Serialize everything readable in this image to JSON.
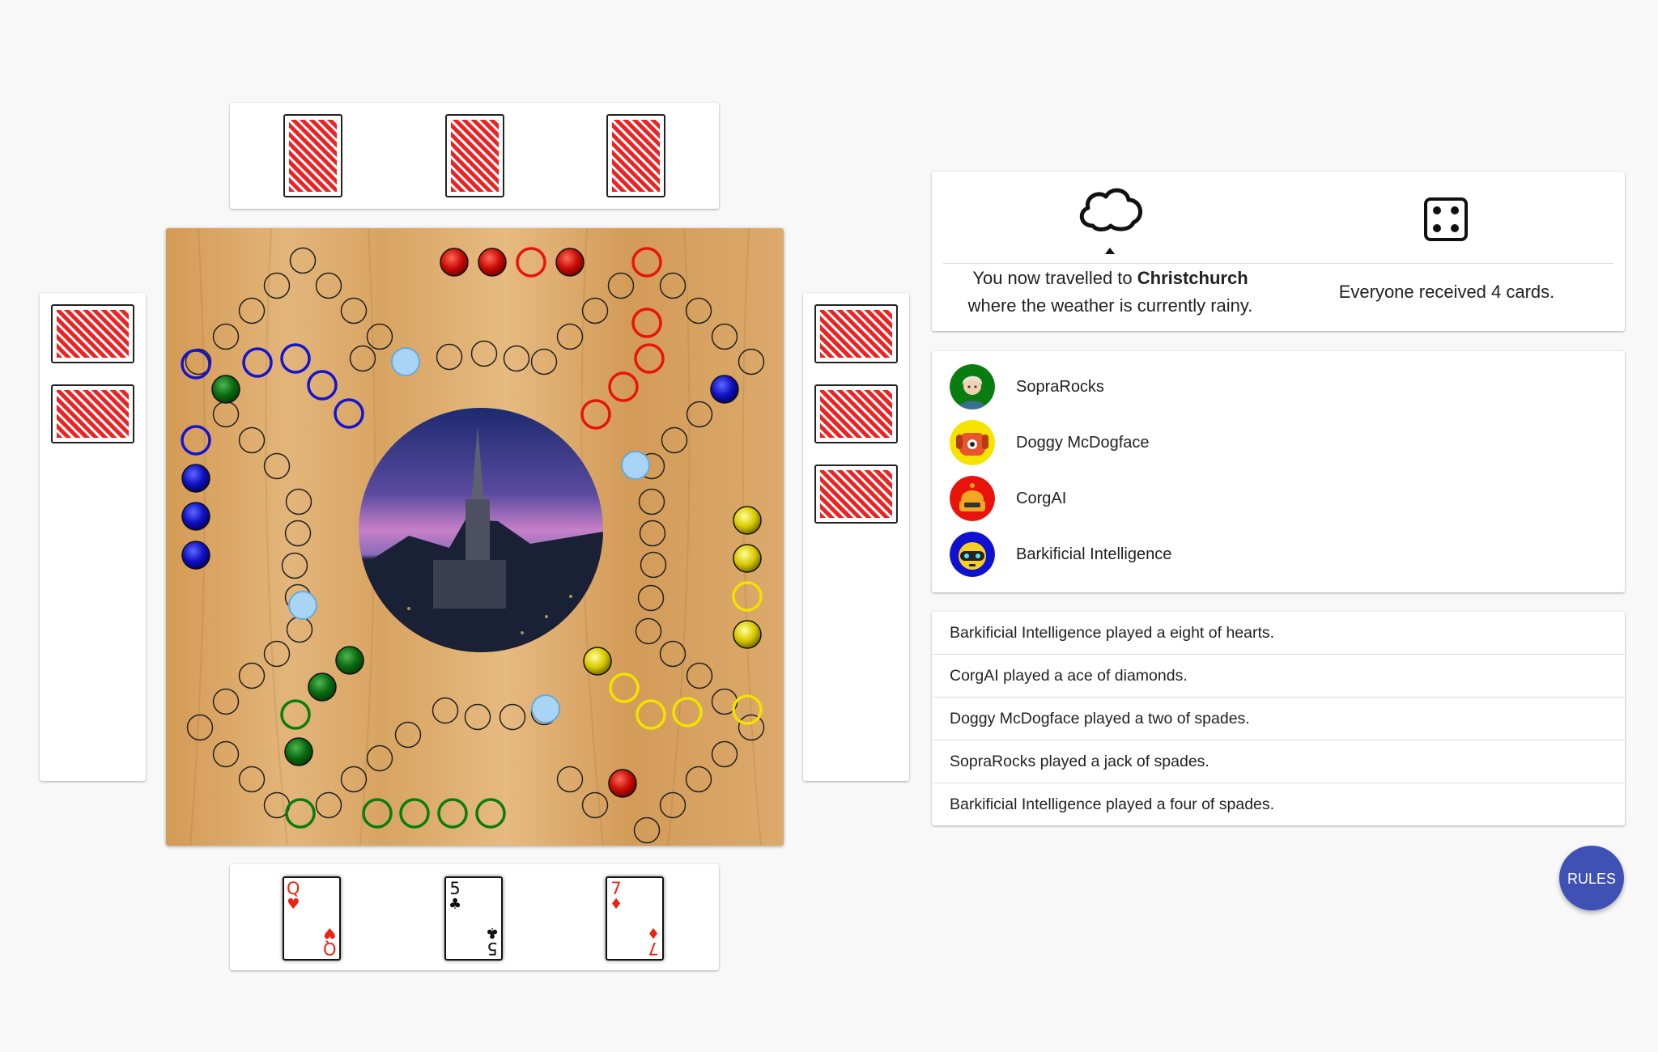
{
  "info": {
    "weather_icon": "cloud-icon",
    "location_prefix": "You now travelled to ",
    "location": "Christchurch",
    "weather_line": "where the weather is currently rainy.",
    "dice_icon": "dice-four-icon",
    "dice_value": 4,
    "cards_message": "Everyone received 4 cards."
  },
  "players": [
    {
      "name": "SopraRocks",
      "color": "#0a7d10",
      "avatar": "grandma-avatar-icon"
    },
    {
      "name": "Doggy McDogface",
      "color": "#f5e400",
      "avatar": "dog-avatar-icon"
    },
    {
      "name": "CorgAI",
      "color": "#e8140c",
      "avatar": "robot-avatar-icon"
    },
    {
      "name": "Barkificial Intelligence",
      "color": "#1010d0",
      "avatar": "robot-dog-avatar-icon"
    }
  ],
  "log": [
    "Barkificial Intelligence played a eight of hearts.",
    "CorgAI played a ace of diamonds.",
    "Doggy McDogface played a two of spades.",
    "SopraRocks played a jack of spades.",
    "Barkificial Intelligence played a four of spades."
  ],
  "hand": [
    {
      "rank": "Q",
      "suit": "♥",
      "color": "#e21"
    },
    {
      "rank": "5",
      "suit": "♣",
      "color": "#111"
    },
    {
      "rank": "7",
      "suit": "♦",
      "color": "#e21"
    }
  ],
  "opponents": {
    "top_card_count": 3,
    "left_card_count": 2,
    "right_card_count": 3
  },
  "board": {
    "center_image": "christchurch-cathedral-image",
    "colors": {
      "red": "#e8140c",
      "blue": "#1414d0",
      "green": "#0a7d10",
      "yellow": "#f2e200",
      "highlight": "#a8d4f5"
    }
  },
  "rules_label": "RULES"
}
